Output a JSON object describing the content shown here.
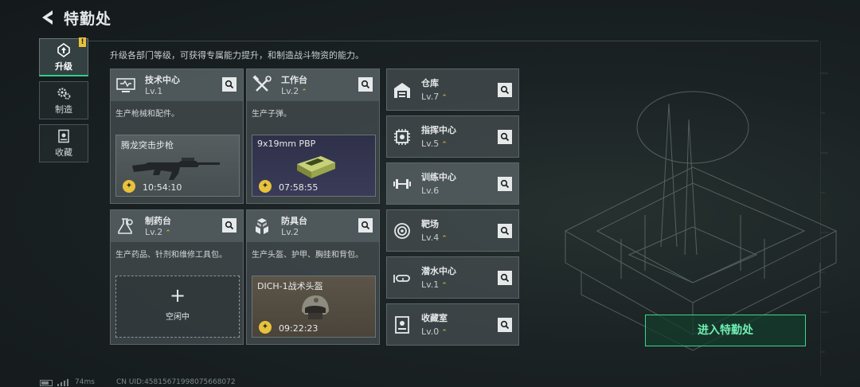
{
  "header": {
    "title": "特勤处"
  },
  "subtitle": "升级各部门等级，可获得专属能力提升，和制造战斗物资的能力。",
  "sidebar": {
    "badge": "!",
    "items": [
      {
        "label": "升级",
        "icon": "upgrade-icon"
      },
      {
        "label": "制造",
        "icon": "gears-icon"
      },
      {
        "label": "收藏",
        "icon": "collection-icon"
      }
    ]
  },
  "workshops": [
    {
      "name": "技术中心",
      "level": "Lv.1",
      "upgradable": false,
      "desc": "生产枪械和配件。",
      "product": "腾龙突击步枪",
      "timer": "10:54:10",
      "icon": "tech-center-icon"
    },
    {
      "name": "工作台",
      "level": "Lv.2",
      "upgradable": true,
      "desc": "生产子弹。",
      "product": "9x19mm PBP",
      "timer": "07:58:55",
      "icon": "workbench-icon"
    },
    {
      "name": "制药台",
      "level": "Lv.2",
      "upgradable": true,
      "desc": "生产药品、针剂和维修工具包。",
      "idle_label": "空闲中",
      "idle_plus": "+",
      "icon": "pharmacy-icon"
    },
    {
      "name": "防具台",
      "level": "Lv.2",
      "upgradable": false,
      "desc": "生产头盔、护甲、胸挂和背包。",
      "product": "DICH-1战术头盔",
      "timer": "09:22:23",
      "icon": "armor-bench-icon"
    }
  ],
  "upgrade_arrow": "⌃",
  "facilities": [
    {
      "name": "仓库",
      "level": "Lv.7",
      "upgradable": true,
      "icon": "warehouse-icon"
    },
    {
      "name": "指挥中心",
      "level": "Lv.5",
      "upgradable": true,
      "icon": "command-center-icon"
    },
    {
      "name": "训练中心",
      "level": "Lv.6",
      "upgradable": false,
      "icon": "training-center-icon"
    },
    {
      "name": "靶场",
      "level": "Lv.4",
      "upgradable": true,
      "icon": "shooting-range-icon"
    },
    {
      "name": "潜水中心",
      "level": "Lv.1",
      "upgradable": true,
      "icon": "diving-center-icon"
    },
    {
      "name": "收藏室",
      "level": "Lv.0",
      "upgradable": true,
      "icon": "collection-room-icon"
    }
  ],
  "enter_button": "进入特勤处",
  "footer": {
    "ping": "74ms",
    "uid": "CN UID:45815671998075668072"
  },
  "colors": {
    "accent_green": "#3bd78f",
    "upgrade_gold": "#e8c23a",
    "panel": "#464f52"
  }
}
